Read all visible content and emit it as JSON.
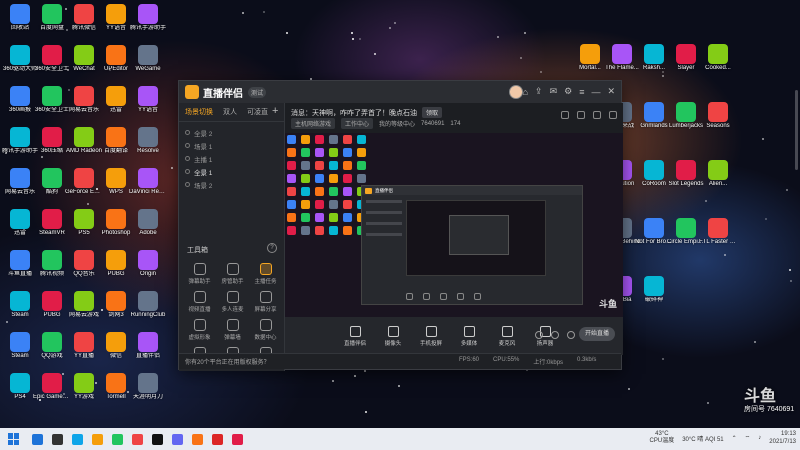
{
  "app": {
    "name": "直播伴侣",
    "version_badge": "测试",
    "tabs": [
      "场景切换",
      "双人",
      "可凌直"
    ],
    "scenes": [
      "全景 2",
      "场景 1",
      "主播 1",
      "全景 1",
      "场景 2"
    ],
    "notice": "消息：天神啊，咋咋了弄首了！晚点石油",
    "notice_tag": "领取",
    "meta": {
      "category": "主机网络游戏",
      "title": "工作中心",
      "room_label": "我的等级中心",
      "room_id": "7640691",
      "fans": "174"
    },
    "toolbox_label": "工具箱",
    "tools": [
      "弹幕助手",
      "房管助手",
      "主播任务",
      "视频直播",
      "多人连麦",
      "屏幕分享",
      "虚拟形象",
      "弹幕墙",
      "数据中心",
      "",
      "",
      ""
    ],
    "controls": [
      "直播伴侣",
      "摄像头",
      "手机投屏",
      "多媒体",
      "麦克风",
      "扬声器"
    ],
    "live_button": "开始直播",
    "footer_text": "你有20个平台正在用版权服务？",
    "footer_stats": [
      "FPS:60",
      "CPU:55%",
      "上行:0kbps",
      "0.3kb/s"
    ],
    "watermark_small": "斗鱼"
  },
  "desktop": {
    "left_icons": [
      "回收站",
      "百度网盘",
      "腾讯微信",
      "YY语音",
      "腾讯手游助手",
      "360驱动大师",
      "360安全卫士",
      "WeChat",
      "UPEditor",
      "WeGame",
      "360画报",
      "360安全卫士",
      "网易云音乐",
      "迅雷",
      "YY语音",
      "腾讯手游助手",
      "360压缩",
      "AMD Radeon",
      "百度翻译",
      "Resolve",
      "网易云音乐",
      "酷狗",
      "GeForce Experience",
      "WPS",
      "DaVinci Resolve",
      "迅雷",
      "SteamVR",
      "PS5",
      "Photoshop",
      "Adobe",
      "斗鱼直播",
      "腾讯视频",
      "QQ音乐",
      "PUBG",
      "Origin",
      "Steam",
      "PUBG",
      "网易云游戏",
      "剑网3",
      "RunningClub",
      "Steam",
      "QQ游戏",
      "YY直播",
      "微信",
      "直播伴侣",
      "PS4",
      "Epic Games Launcher",
      "YY游戏",
      "Tormell",
      "天涯明月刀"
    ],
    "right_icons": [
      "Mortal...",
      "The Flame...",
      "Raksh...",
      "Slayer",
      "Cooked...",
      "Monster Prom",
      "一起来战",
      "Grimlands",
      "Lumberjacks",
      "Seasons",
      "CHANCE A Homeless...",
      "Evolution",
      "CoRoom",
      "Slot Legends",
      "Alien...",
      "神界",
      "Home Behind",
      "Not For Broadcast",
      "Circle Empires",
      "FTL Faster Than Light",
      "Uplay",
      "Big Bia",
      "破碎神"
    ],
    "watermark": "斗鱼",
    "watermark_sub": "房间号 7640691"
  },
  "taskbar": {
    "weather_temp": "43°C",
    "weather_label": "CPU温度",
    "tray_text": "30°C 晴 AQI 51",
    "time": "19:13",
    "date": "2021/7/13"
  },
  "colors": {
    "accent": "#f5a623",
    "window_bg": "#25272c",
    "taskbar_bg": "#e9ecf2"
  }
}
